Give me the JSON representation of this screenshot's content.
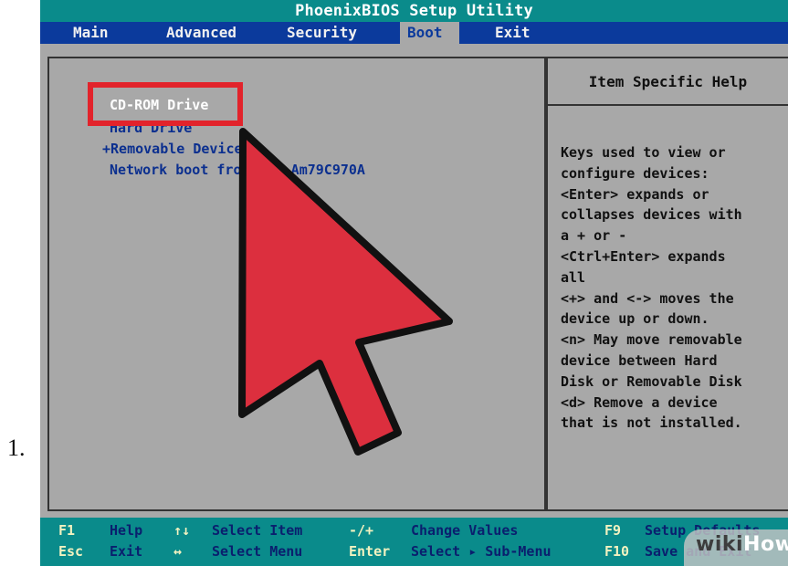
{
  "list_marker": "1.",
  "bios": {
    "title": "PhoenixBIOS Setup Utility",
    "menu": [
      {
        "label": "Main"
      },
      {
        "label": "Advanced"
      },
      {
        "label": "Security"
      },
      {
        "label": "Boot",
        "active": true
      },
      {
        "label": "Exit"
      }
    ],
    "boot_order": [
      {
        "label": "CD-ROM Drive",
        "selected": true
      },
      {
        "label": "Hard Drive"
      },
      {
        "label": "+Removable Devices"
      },
      {
        "label": "Network boot from AMD Am79C970A"
      }
    ],
    "help": {
      "title": "Item Specific Help",
      "lines": [
        "Keys used to view or",
        "configure devices:",
        "<Enter> expands or",
        "collapses devices with",
        "a + or -",
        "<Ctrl+Enter> expands",
        "all",
        "<+> and <-> moves the",
        "device up or down.",
        "<n> May move removable",
        "device between Hard",
        "Disk or Removable Disk",
        "<d> Remove a device",
        "that is not installed."
      ]
    },
    "key_bar": {
      "row1": [
        {
          "key": "F1",
          "desc": "Help"
        },
        {
          "key": "↑↓",
          "desc": "Select Item"
        },
        {
          "key": "-/+",
          "desc": "Change Values"
        },
        {
          "key": "F9",
          "desc": "Setup Defaults"
        }
      ],
      "row2": [
        {
          "key": "Esc",
          "desc": "Exit"
        },
        {
          "key": "↔",
          "desc": "Select Menu"
        },
        {
          "key": "Enter",
          "desc": "Select ▸ Sub-Menu"
        },
        {
          "key": "F10",
          "desc": "Save and Exit"
        }
      ]
    }
  },
  "watermark": {
    "wiki": "wiki",
    "how": "How"
  },
  "colors": {
    "screen_gray": "#a8a8a8",
    "title_teal": "#0a8b8b",
    "menu_blue": "#0b3a9c",
    "item_blue": "#0b2f8f",
    "highlight_red": "#e2232b",
    "arrow_red": "#dc2f3e"
  },
  "icons": {
    "cursor": "red-pointer-arrow-icon"
  }
}
